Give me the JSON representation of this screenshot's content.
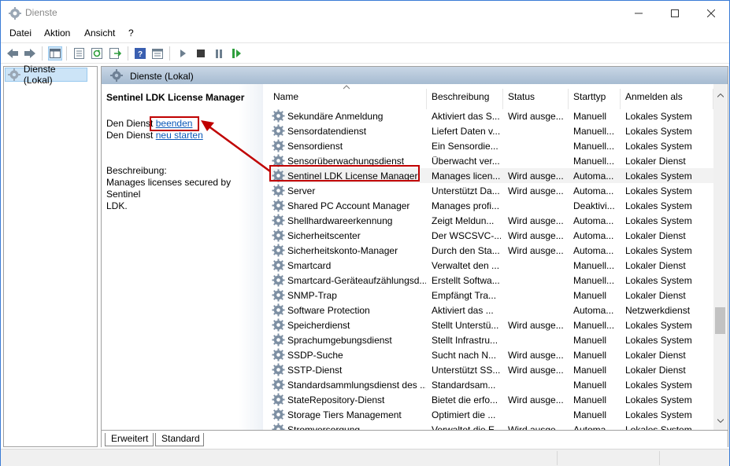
{
  "window": {
    "title": "Dienste"
  },
  "menu": [
    "Datei",
    "Aktion",
    "Ansicht",
    "?"
  ],
  "tree": {
    "selected": "Dienste (Lokal)"
  },
  "header": {
    "title": "Dienste (Lokal)"
  },
  "extended": {
    "service_name": "Sentinel LDK License Manager",
    "line1_prefix": "Den Dienst",
    "line1_link": "beenden",
    "line2_prefix": "Den Dienst",
    "line2_link": "neu starten",
    "desc_label": "Beschreibung:",
    "desc_text_1": "Manages licenses secured by Sentinel",
    "desc_text_2": "LDK."
  },
  "columns": {
    "name": "Name",
    "description": "Beschreibung",
    "status": "Status",
    "starttype": "Starttyp",
    "logon": "Anmelden als"
  },
  "services": [
    {
      "name": "Sekundäre Anmeldung",
      "desc": "Aktiviert das S...",
      "status": "Wird ausge...",
      "start": "Manuell",
      "logon": "Lokales System"
    },
    {
      "name": "Sensordatendienst",
      "desc": "Liefert Daten v...",
      "status": "",
      "start": "Manuell...",
      "logon": "Lokales System"
    },
    {
      "name": "Sensordienst",
      "desc": "Ein Sensordie...",
      "status": "",
      "start": "Manuell...",
      "logon": "Lokales System"
    },
    {
      "name": "Sensorüberwachungsdienst",
      "desc": "Überwacht ver...",
      "status": "",
      "start": "Manuell...",
      "logon": "Lokaler Dienst"
    },
    {
      "name": "Sentinel LDK License Manager",
      "desc": "Manages licen...",
      "status": "Wird ausge...",
      "start": "Automa...",
      "logon": "Lokales System",
      "selected": true
    },
    {
      "name": "Server",
      "desc": "Unterstützt Da...",
      "status": "Wird ausge...",
      "start": "Automa...",
      "logon": "Lokales System"
    },
    {
      "name": "Shared PC Account Manager",
      "desc": "Manages profi...",
      "status": "",
      "start": "Deaktivi...",
      "logon": "Lokales System"
    },
    {
      "name": "Shellhardwareerkennung",
      "desc": "Zeigt Meldun...",
      "status": "Wird ausge...",
      "start": "Automa...",
      "logon": "Lokales System"
    },
    {
      "name": "Sicherheitscenter",
      "desc": "Der WSCSVC-...",
      "status": "Wird ausge...",
      "start": "Automa...",
      "logon": "Lokaler Dienst"
    },
    {
      "name": "Sicherheitskonto-Manager",
      "desc": "Durch den Sta...",
      "status": "Wird ausge...",
      "start": "Automa...",
      "logon": "Lokales System"
    },
    {
      "name": "Smartcard",
      "desc": "Verwaltet den ...",
      "status": "",
      "start": "Manuell...",
      "logon": "Lokaler Dienst"
    },
    {
      "name": "Smartcard-Geräteaufzählungsd...",
      "desc": "Erstellt Softwa...",
      "status": "",
      "start": "Manuell...",
      "logon": "Lokales System"
    },
    {
      "name": "SNMP-Trap",
      "desc": "Empfängt Tra...",
      "status": "",
      "start": "Manuell",
      "logon": "Lokaler Dienst"
    },
    {
      "name": "Software Protection",
      "desc": "Aktiviert das ...",
      "status": "",
      "start": "Automa...",
      "logon": "Netzwerkdienst"
    },
    {
      "name": "Speicherdienst",
      "desc": "Stellt Unterstü...",
      "status": "Wird ausge...",
      "start": "Manuell...",
      "logon": "Lokales System"
    },
    {
      "name": "Sprachumgebungsdienst",
      "desc": "Stellt Infrastru...",
      "status": "",
      "start": "Manuell",
      "logon": "Lokales System"
    },
    {
      "name": "SSDP-Suche",
      "desc": "Sucht nach N...",
      "status": "Wird ausge...",
      "start": "Manuell",
      "logon": "Lokaler Dienst"
    },
    {
      "name": "SSTP-Dienst",
      "desc": "Unterstützt SS...",
      "status": "Wird ausge...",
      "start": "Manuell",
      "logon": "Lokaler Dienst"
    },
    {
      "name": "Standardsammlungsdienst des ...",
      "desc": "Standardsam...",
      "status": "",
      "start": "Manuell",
      "logon": "Lokales System"
    },
    {
      "name": "StateRepository-Dienst",
      "desc": "Bietet die erfo...",
      "status": "Wird ausge...",
      "start": "Manuell",
      "logon": "Lokales System"
    },
    {
      "name": "Storage Tiers Management",
      "desc": "Optimiert die ...",
      "status": "",
      "start": "Manuell",
      "logon": "Lokales System"
    },
    {
      "name": "Stromversorgung",
      "desc": "Verwaltet die E...",
      "status": "Wird ausge...",
      "start": "Automa...",
      "logon": "Lokales System"
    }
  ],
  "tabs": [
    "Erweitert",
    "Standard"
  ],
  "colors": {
    "highlight": "#c00000",
    "link": "#0b58b8",
    "header_band": "#a6bbd1"
  }
}
